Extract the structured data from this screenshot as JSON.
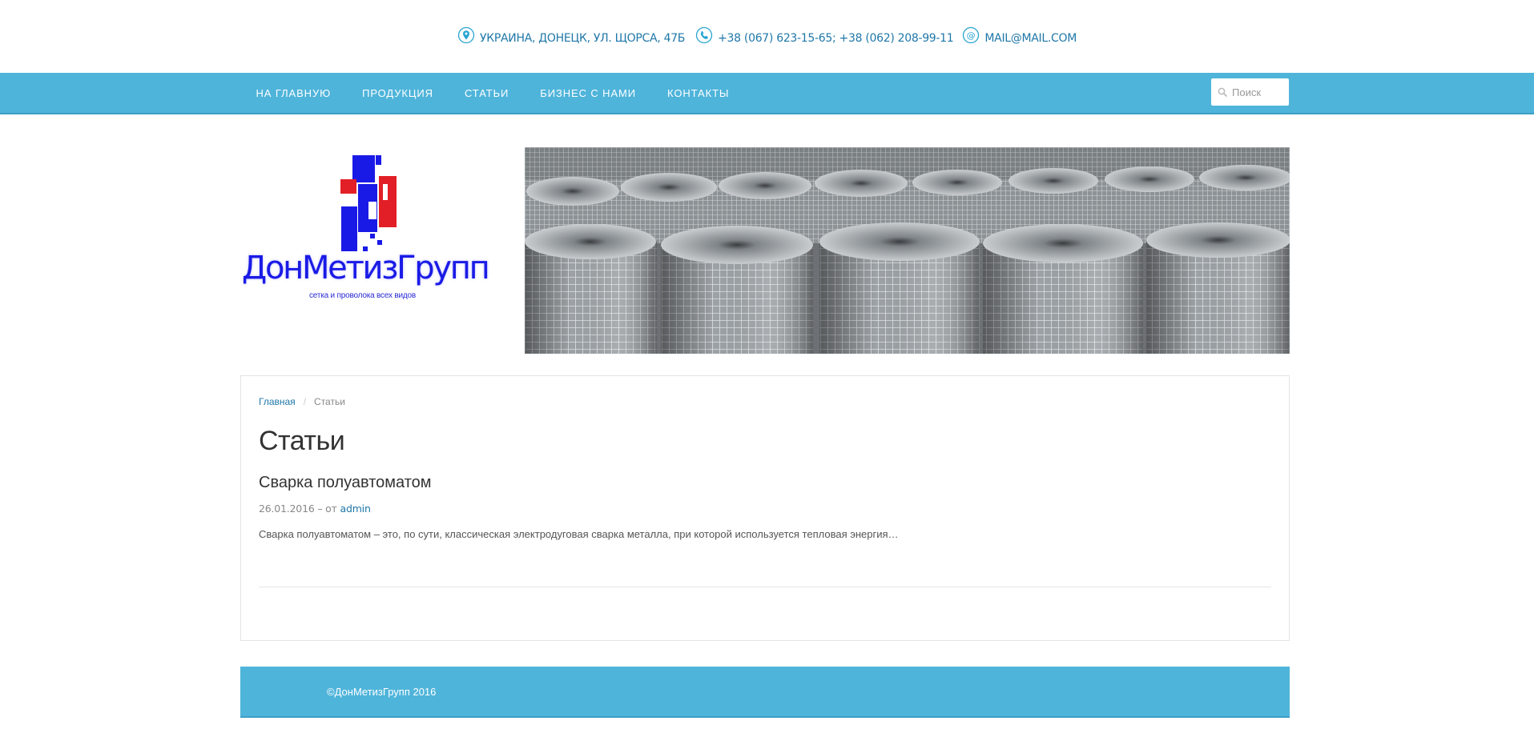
{
  "contacts": {
    "address": "УКРАИНА, ДОНЕЦК, УЛ. ЩОРСА, 47Б",
    "phones": "+38 (067) 623-15-65; +38 (062) 208-99-11",
    "email": "MAIL@MAIL.COM",
    "icons": [
      "location-pin-icon",
      "phone-icon",
      "at-sign-icon"
    ],
    "icon_color": "#2aa5d1",
    "text_color": "#1f77a8"
  },
  "nav": {
    "items": [
      {
        "label": "НА ГЛАВНУЮ"
      },
      {
        "label": "ПРОДУКЦИЯ"
      },
      {
        "label": "СТАТЬИ"
      },
      {
        "label": "БИЗНЕС С НАМИ"
      },
      {
        "label": "КОНТАКТЫ"
      }
    ],
    "background": "#4fb4da",
    "search": {
      "placeholder": "Поиск",
      "icon": "magnifier-icon"
    }
  },
  "header": {
    "logo_name": "ДонМетизГрупп",
    "logo_tagline": "сетка и проволока всех видов",
    "logo_colors": [
      "#1a1ae6",
      "#e21f26"
    ]
  },
  "breadcrumb": {
    "home": "Главная",
    "separator": "/",
    "current": "Статьи"
  },
  "page": {
    "title": "Статьи",
    "posts": [
      {
        "title": "Сварка полуавтоматом",
        "date": "26.01.2016",
        "by": "– от",
        "author": "admin",
        "excerpt": "Сварка полуавтоматом – это, по сути, классическая электродуговая сварка металла, при которой используется тепловая энергия…"
      }
    ]
  },
  "footer": {
    "copyright": "©ДонМетизГрупп 2016"
  }
}
